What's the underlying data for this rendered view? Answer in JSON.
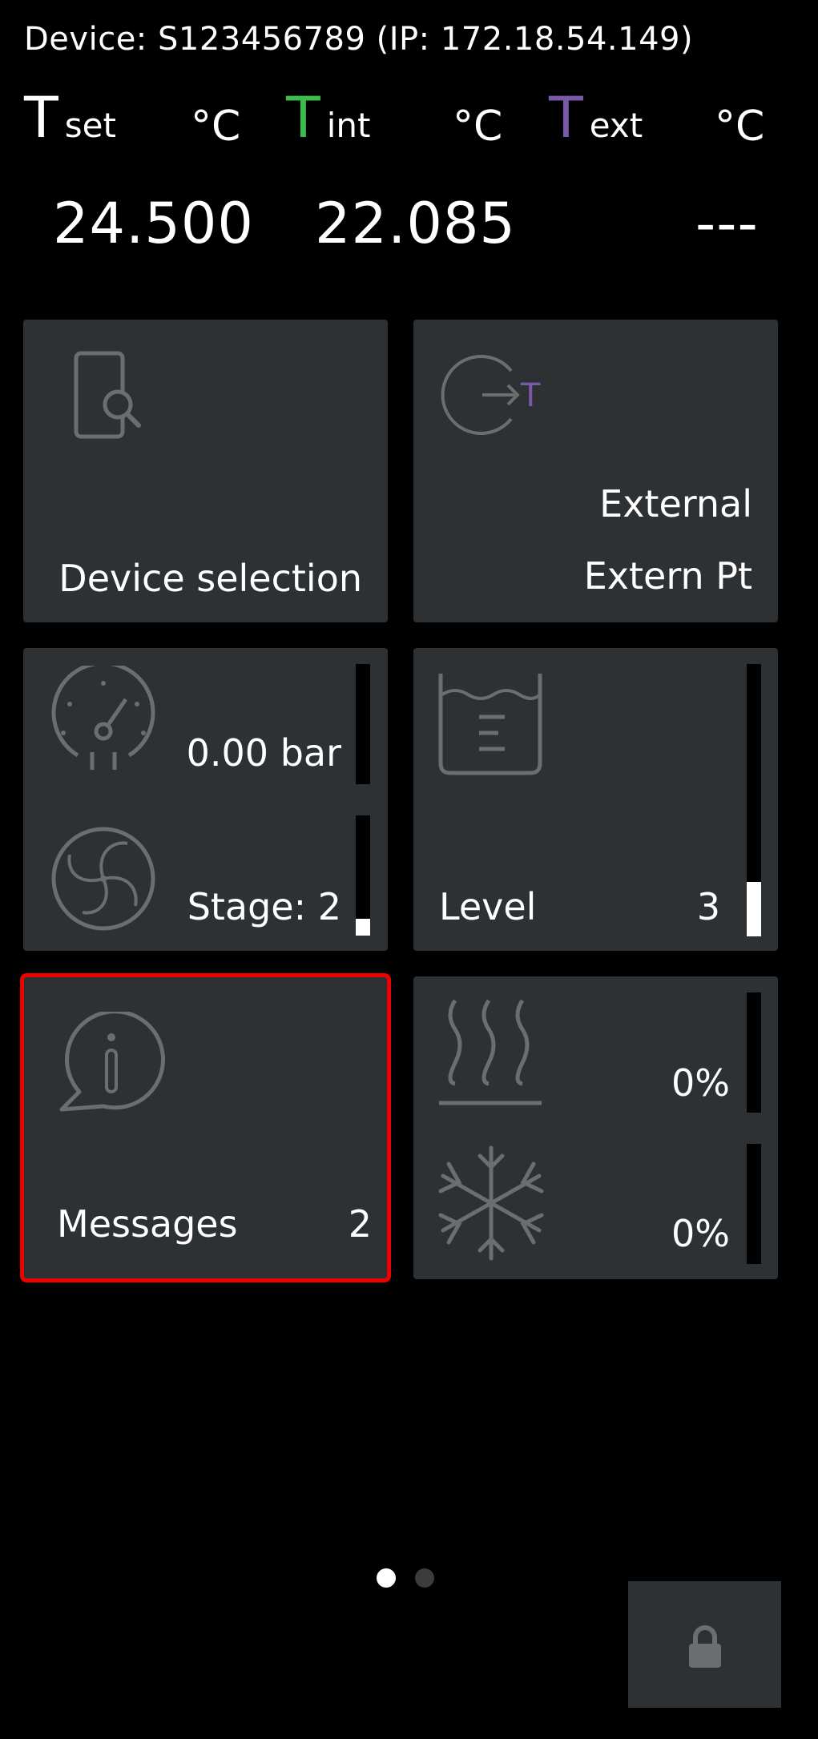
{
  "header": {
    "device_line": "Device: S123456789 (IP: 172.18.54.149)"
  },
  "temps": {
    "set": {
      "T": "T",
      "sub": "set",
      "unit": "°C",
      "value": "24.500",
      "color": "#ffffff"
    },
    "int": {
      "T": "T",
      "sub": "int",
      "unit": "°C",
      "value": "22.085",
      "color": "#3dbb4c"
    },
    "ext": {
      "T": "T",
      "sub": "ext",
      "unit": "°C",
      "value": "---",
      "color": "#7a5aa8"
    }
  },
  "tiles": {
    "device_selection": {
      "label": "Device selection",
      "icon": "device-search-icon"
    },
    "external": {
      "line1": "External",
      "line2": "Extern Pt",
      "icon": "external-temp-icon",
      "accent": "#7a5aa8"
    },
    "pump": {
      "pressure": "0.00 bar",
      "pressure_level": 0,
      "stage": "Stage: 2",
      "stage_level": 0.1
    },
    "level": {
      "label": "Level",
      "value": "3",
      "level": 0.33
    },
    "messages": {
      "label": "Messages",
      "count": "2"
    },
    "heat_cool": {
      "heating": "0%",
      "heating_level": 0,
      "cooling": "0%",
      "cooling_level": 0
    }
  },
  "pager": {
    "current": 1,
    "total": 2
  },
  "colors": {
    "tile_bg": "#2e3134",
    "icon": "#6b6e71",
    "highlight": "#e00000"
  }
}
